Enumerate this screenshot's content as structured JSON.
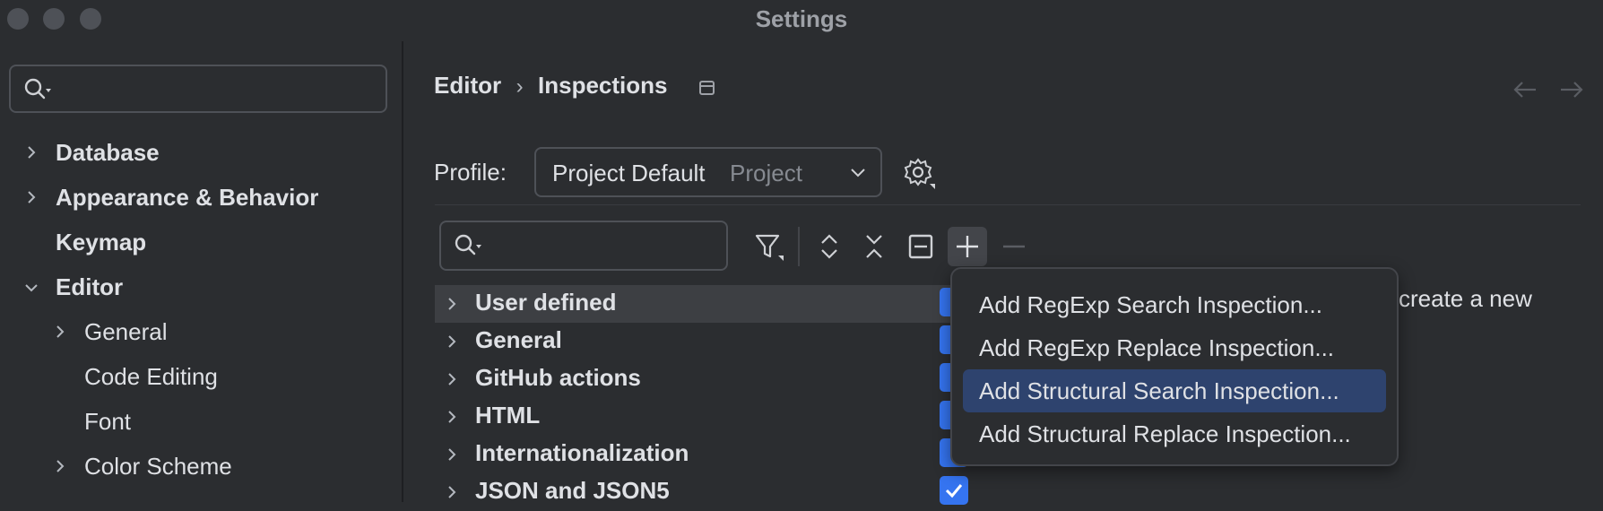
{
  "window": {
    "title": "Settings"
  },
  "sidebar": {
    "search_placeholder": "",
    "items": [
      {
        "label": "Database",
        "bold": true,
        "expandable": true,
        "expanded": false
      },
      {
        "label": "Appearance & Behavior",
        "bold": true,
        "expandable": true,
        "expanded": false
      },
      {
        "label": "Keymap",
        "bold": true,
        "expandable": false
      },
      {
        "label": "Editor",
        "bold": true,
        "expandable": true,
        "expanded": true
      },
      {
        "label": "General",
        "bold": false,
        "expandable": true,
        "expanded": false
      },
      {
        "label": "Code Editing",
        "bold": false,
        "expandable": false
      },
      {
        "label": "Font",
        "bold": false,
        "expandable": false
      },
      {
        "label": "Color Scheme",
        "bold": false,
        "expandable": true,
        "expanded": false
      }
    ]
  },
  "breadcrumb": {
    "parent": "Editor",
    "separator": "›",
    "current": "Inspections"
  },
  "profile": {
    "label": "Profile:",
    "value": "Project Default",
    "scope": "Project"
  },
  "inspections": {
    "search_placeholder": "",
    "rows": [
      {
        "label": "User defined",
        "checked": true
      },
      {
        "label": "General",
        "checked": true
      },
      {
        "label": "GitHub actions",
        "checked": true
      },
      {
        "label": "HTML",
        "checked": true
      },
      {
        "label": "Internationalization",
        "checked": true
      },
      {
        "label": "JSON and JSON5",
        "checked": true
      }
    ]
  },
  "add_menu": {
    "items": [
      {
        "label": "Add RegExp Search Inspection..."
      },
      {
        "label": "Add RegExp Replace Inspection..."
      },
      {
        "label": "Add Structural Search Inspection...",
        "active": true
      },
      {
        "label": "Add Structural Replace Inspection..."
      }
    ]
  },
  "hint_text": "create a new",
  "colors": {
    "accent": "#3574f0",
    "menu_highlight": "#2e436e",
    "background": "#2b2d30"
  },
  "icons": [
    "search-icon",
    "filter-icon",
    "expand-all-icon",
    "collapse-all-icon",
    "group-icon",
    "add-icon",
    "remove-icon",
    "gear-icon",
    "back-arrow-icon",
    "forward-arrow-icon"
  ]
}
